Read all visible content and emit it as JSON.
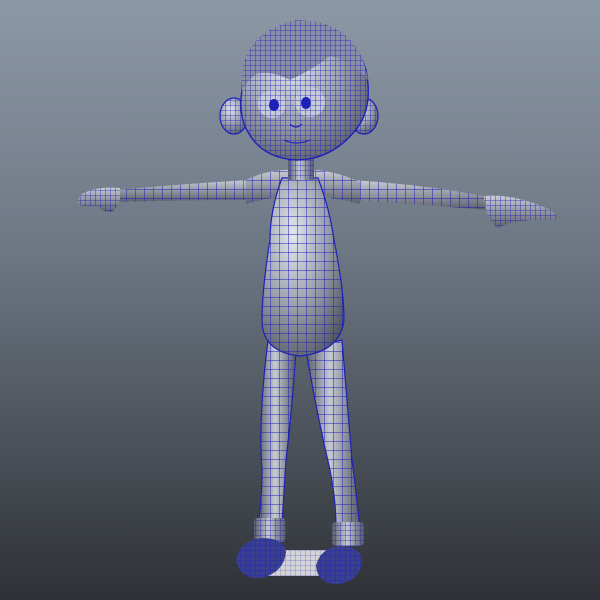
{
  "viewport": {
    "background_top": "#8d98a6",
    "background_bottom": "#2e3136"
  },
  "model": {
    "shading": "wireframe-on-shaded",
    "pose": "T-pose",
    "surface_color": "#9aa0ad",
    "wire_color": "#1e21b8",
    "shadow_color": "#e8e8e8"
  }
}
